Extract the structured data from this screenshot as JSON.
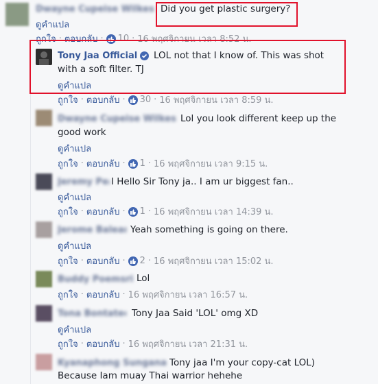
{
  "common": {
    "translate": "ดูคำแปล",
    "like": "ถูกใจ",
    "reply": "ตอบกลับ",
    "separator": "·"
  },
  "comments": [
    {
      "name": "Dwayne Cupeise Wilkes",
      "text": "Did you get plastic surgery?",
      "likes": "10",
      "time": "16 พฤศจิกายน เวลา 8:52 น."
    },
    {
      "name": "Tony Jaa Official",
      "text1": "LOL not that I know of. This was shot",
      "text2": "with a soft filter. TJ",
      "likes": "30",
      "time": "16 พฤศจิกายน เวลา 8:59 น."
    },
    {
      "name": "Dwayne Cupeise Wilkes",
      "text1": "Lol you look different keep up the",
      "text2": "good work",
      "likes": "1",
      "time": "16 พฤศจิกายน เวลา 9:15 น."
    },
    {
      "name": "Jeremy Pearl",
      "text": "I Hello Sir Tony ja.. I am ur biggest fan..",
      "likes": "1",
      "time": "16 พฤศจิกายน เวลา 14:39 น."
    },
    {
      "name": "Jerome Balean",
      "text": "Yeah something is going on there.",
      "likes": "2",
      "time": "16 พฤศจิกายน เวลา 15:02 น."
    },
    {
      "name": "Buddy Poemsri",
      "text": "Lol",
      "time": "16 พฤศจิกายน เวลา 16:57 น."
    },
    {
      "name": "Tona Bontatee",
      "text": "Tony Jaa Said 'LOL' omg XD",
      "time": "16 พฤศจิกายน เวลา 21:31 น."
    },
    {
      "name": "Kyanaphong Sunganakuzhae",
      "text1": "Tony jaa I'm your copy-cat LOL)",
      "text2": "Because Iam muay Thai warrior hehehe"
    }
  ]
}
